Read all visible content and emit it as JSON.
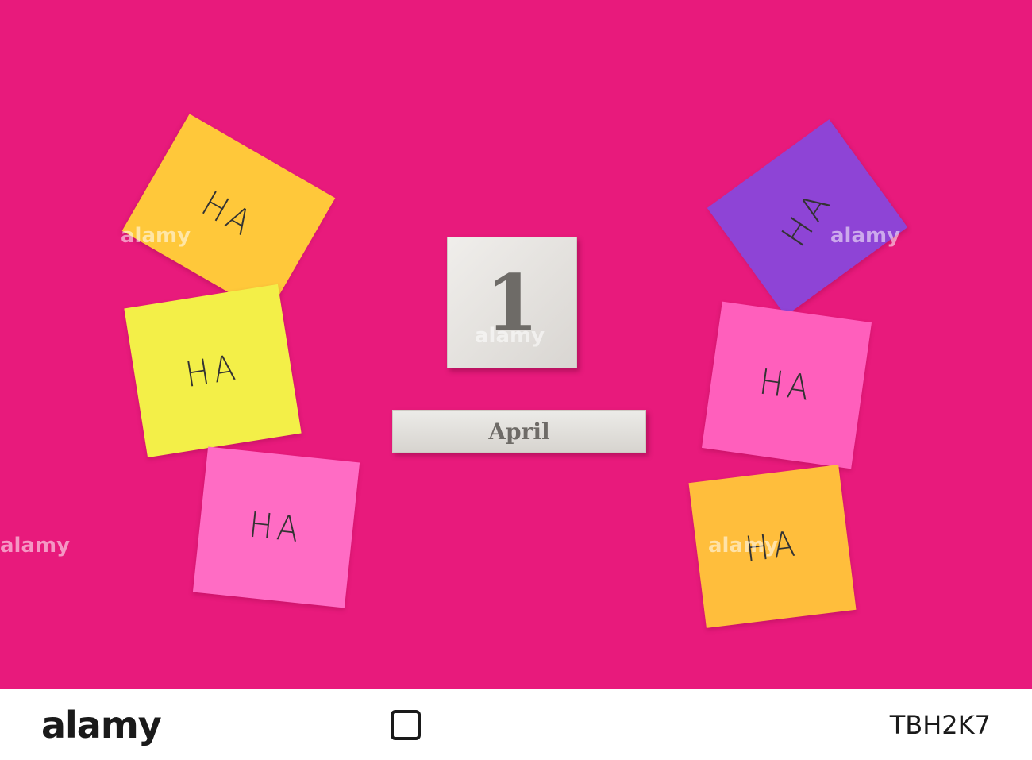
{
  "calendar": {
    "day": "1",
    "month": "April"
  },
  "notes": [
    {
      "text": "HA",
      "color": "#ffc83a"
    },
    {
      "text": "HA",
      "color": "#f3ef48"
    },
    {
      "text": "HA",
      "color": "#ff6cc4"
    },
    {
      "text": "HA",
      "color": "#8e44d6"
    },
    {
      "text": "HA",
      "color": "#ff5fbc"
    },
    {
      "text": "HA",
      "color": "#ffbe3c"
    }
  ],
  "watermark": {
    "text": "alamy"
  },
  "footer": {
    "brand": "alamy",
    "image_code": "TBH2K7"
  }
}
